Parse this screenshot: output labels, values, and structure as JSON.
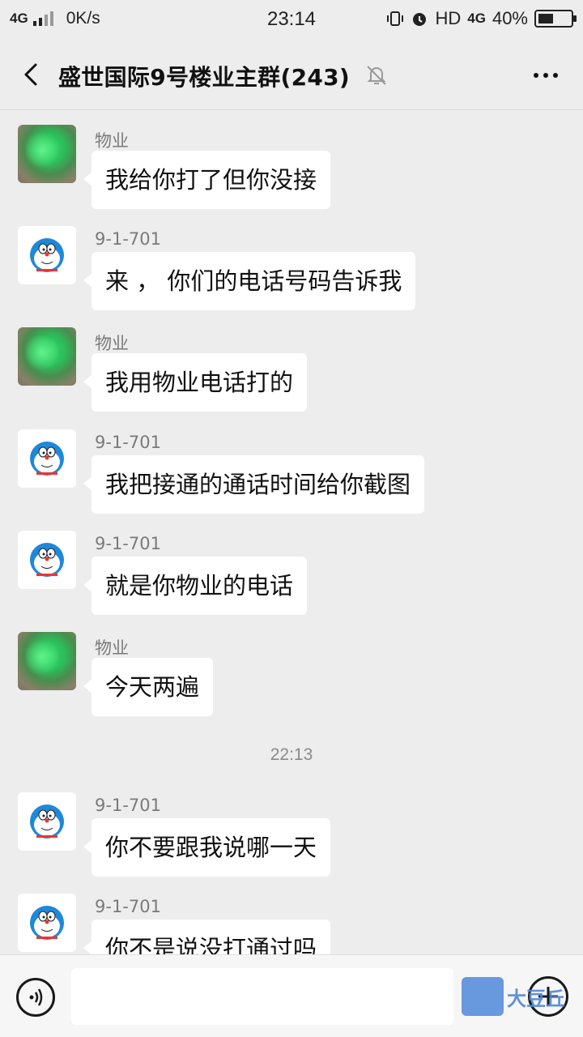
{
  "status_bar": {
    "network": "4G",
    "speed": "0K/s",
    "time": "23:14",
    "hd": "HD",
    "net2": "4G",
    "battery": "40%",
    "battery_level": 0.4
  },
  "header": {
    "title": "盛世国际9号楼业主群(243)",
    "back_icon": "chevron-left-icon",
    "mute_icon": "bell-off-icon",
    "more_icon": "more-dots-icon"
  },
  "messages": [
    {
      "sender": "物业",
      "text": "我给你打了但你没接",
      "avatar": "green"
    },
    {
      "sender": "9-1-701",
      "text": "来 ， 你们的电话号码告诉我",
      "avatar": "doraemon"
    },
    {
      "sender": "物业",
      "text": "我用物业电话打的",
      "avatar": "green"
    },
    {
      "sender": "9-1-701",
      "text": "我把接通的通话时间给你截图",
      "avatar": "doraemon"
    },
    {
      "sender": "9-1-701",
      "text": "就是你物业的电话",
      "avatar": "doraemon"
    },
    {
      "sender": "物业",
      "text": "今天两遍",
      "avatar": "green"
    },
    {
      "sender": "9-1-701",
      "text": "你不要跟我说哪一天",
      "avatar": "doraemon"
    },
    {
      "sender": "9-1-701",
      "text": "你不是说没打通过吗",
      "avatar": "doraemon"
    }
  ],
  "timestamp": "22:13",
  "input_bar": {
    "voice_icon": "voice-icon",
    "emoji_icon": "emoji-icon",
    "plus_icon": "plus-icon"
  },
  "watermark": "大豆丘"
}
